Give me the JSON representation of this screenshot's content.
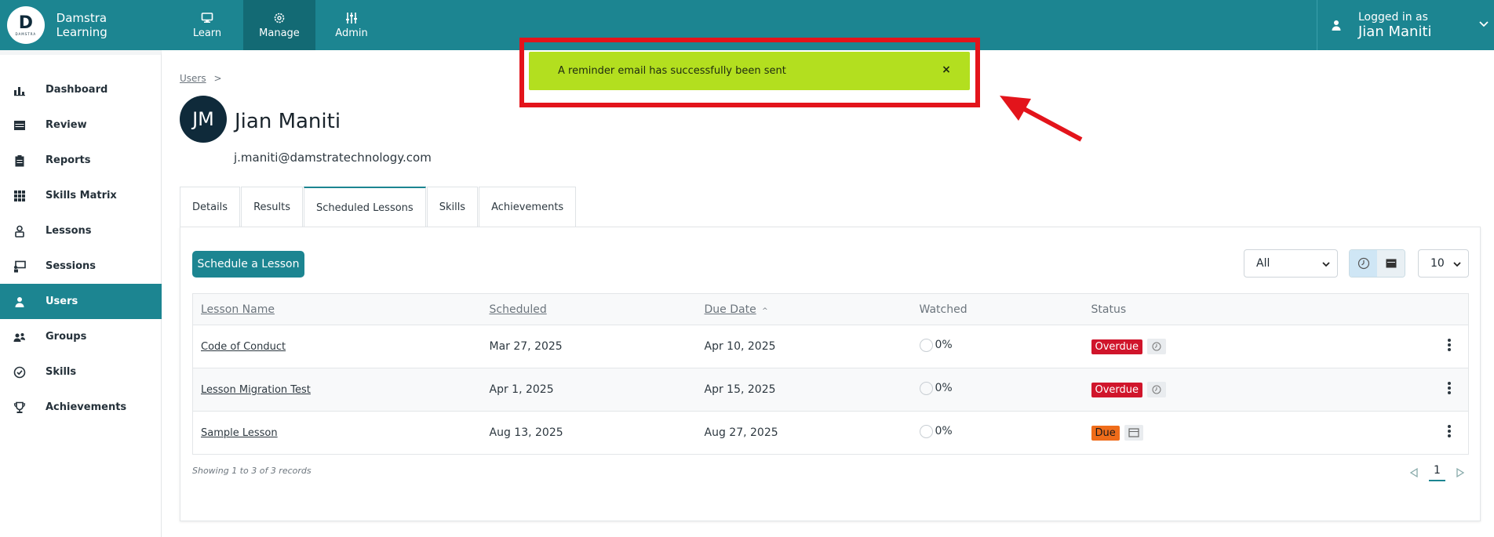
{
  "brand": {
    "name": "Damstra Learning",
    "logo_letter": "D",
    "logo_word": "DAMSTRA"
  },
  "nav": [
    {
      "label": "Learn",
      "icon": "monitor-icon"
    },
    {
      "label": "Manage",
      "icon": "gear-icon",
      "active": true
    },
    {
      "label": "Admin",
      "icon": "sliders-icon"
    }
  ],
  "user_menu": {
    "line1": "Logged in as",
    "line2": "Jian Maniti"
  },
  "sidebar": {
    "items": [
      {
        "label": "Dashboard",
        "icon": "bar-chart-icon"
      },
      {
        "label": "Review",
        "icon": "calendar-icon"
      },
      {
        "label": "Reports",
        "icon": "clipboard-icon"
      },
      {
        "label": "Skills Matrix",
        "icon": "grid-icon"
      },
      {
        "label": "Lessons",
        "icon": "lesson-icon"
      },
      {
        "label": "Sessions",
        "icon": "presentation-icon"
      },
      {
        "label": "Users",
        "icon": "user-icon",
        "active": true
      },
      {
        "label": "Groups",
        "icon": "group-icon"
      },
      {
        "label": "Skills",
        "icon": "check-circle-icon"
      },
      {
        "label": "Achievements",
        "icon": "trophy-icon"
      }
    ]
  },
  "breadcrumb": {
    "link": "Users",
    "separator": ">"
  },
  "profile": {
    "initials": "JM",
    "name": "Jian Maniti",
    "email": "j.maniti@damstratechnology.com"
  },
  "tabs": [
    {
      "label": "Details"
    },
    {
      "label": "Results"
    },
    {
      "label": "Scheduled Lessons",
      "active": true
    },
    {
      "label": "Skills"
    },
    {
      "label": "Achievements"
    }
  ],
  "actions": {
    "schedule_label": "Schedule a Lesson"
  },
  "filters": {
    "status_value": "All",
    "per_page_value": "10"
  },
  "table": {
    "headers": [
      "Lesson Name",
      "Scheduled",
      "Due Date",
      "Watched",
      "Status"
    ],
    "sort_indicator": "^",
    "rows": [
      {
        "name": "Code of Conduct",
        "scheduled": "Mar 27, 2025",
        "due": "Apr 10, 2025",
        "watched": "0%",
        "status": "Overdue"
      },
      {
        "name": "Lesson Migration Test",
        "scheduled": "Apr 1, 2025",
        "due": "Apr 15, 2025",
        "watched": "0%",
        "status": "Overdue"
      },
      {
        "name": "Sample Lesson",
        "scheduled": "Aug 13, 2025",
        "due": "Aug 27, 2025",
        "watched": "0%",
        "status": "Due"
      }
    ]
  },
  "footer": {
    "records": "Showing 1 to 3 of 3 records",
    "page": "1"
  },
  "toast": {
    "message": "A reminder email has successfully been sent",
    "close": "×"
  },
  "colors": {
    "primary": "#1c8591",
    "overdue": "#d0152b",
    "due": "#ef6c1a",
    "toast": "#b3df1f",
    "annotation": "#e3141b"
  }
}
